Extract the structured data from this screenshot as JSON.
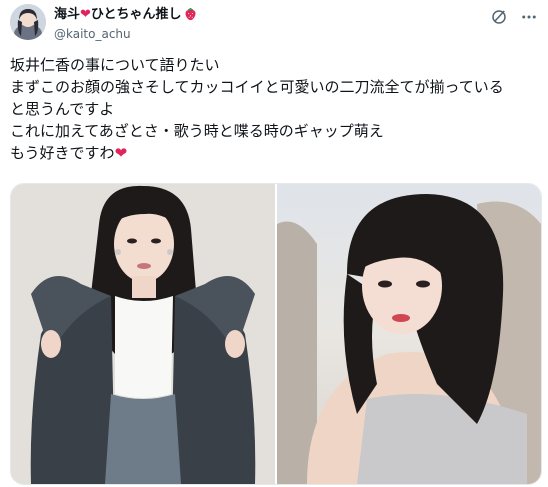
{
  "user": {
    "display_name_prefix": "海斗",
    "heart": "❤",
    "display_name_suffix": "ひとちゃん推し",
    "strawberry_icon": "strawberry-icon",
    "handle": "@kaito_achu"
  },
  "tweet": {
    "lines": [
      "坂井仁香の事について語りたい",
      "まずこのお顔の強さそしてカッコイイと可愛いの二刀流全てが揃っている",
      "と思うんですよ",
      "これに加えてあざとさ・歌う時と喋る時のギャップ萌え",
      "もう好きですわ"
    ],
    "end_heart": "❤"
  },
  "icons": {
    "grok": "slash-circle-icon",
    "more": "more-dots-icon"
  },
  "colors": {
    "heart": "#e0245e",
    "text": "#0f1419",
    "muted": "#536471"
  }
}
